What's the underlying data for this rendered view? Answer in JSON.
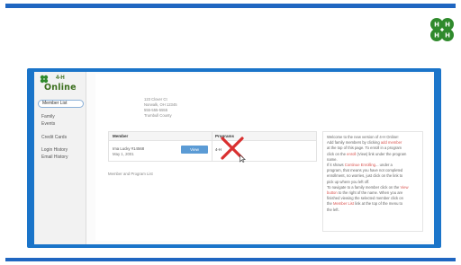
{
  "logo": {
    "brand": "4-H",
    "product": "Online"
  },
  "sidebar": {
    "items": [
      {
        "label": "Member List",
        "active": true
      },
      {
        "label": "Family"
      },
      {
        "label": "Events"
      },
      {
        "label": "Credit Cards"
      },
      {
        "label": "Login History"
      },
      {
        "label": "Email History"
      }
    ]
  },
  "address": {
    "line1": "123 Clover Ct",
    "line2": "Norwalk, OH 12345",
    "line3": "555-555-5555",
    "line4": "Trumbull County"
  },
  "member_panel": {
    "col_member": "Member",
    "col_programs": "Programs",
    "member_name": "Ima Lucky #14568",
    "member_date": "May 1, 2001",
    "view_label": "View",
    "program": "4-H"
  },
  "footer_link": "Member and Program List",
  "info": {
    "p1": "Welcome to the new version of 4-H Online!",
    "p2a": "Add family members by clicking ",
    "p2_hl": "add member",
    "p3": "at the top of this page. To enroll in a program",
    "p4a": "click on the ",
    "p4_hl": "enroll",
    "p4b": " (View) link under the program",
    "p5": "name.",
    "p6a": "If it shows ",
    "p6_hl": "Continue Enrolling",
    "p6b": "... under a",
    "p7": "program, that means you have not completed",
    "p8": "enrollment, no worries, just click on the link to",
    "p9": "pick up where you left off.",
    "p10": "To navigate to a family member click on the ",
    "p10_hl": "View",
    "p11_hl": "button",
    "p11b": " to the right of the name. When you are",
    "p12": "finished viewing the selected member click on",
    "p13a": "the ",
    "p13_hl": "Member List",
    "p13b": " link at the top of the menu to",
    "p14": "the left."
  },
  "colors": {
    "accent": "#1f66c1",
    "clover_green": "#2f8a2c",
    "x_red": "#d93030"
  }
}
